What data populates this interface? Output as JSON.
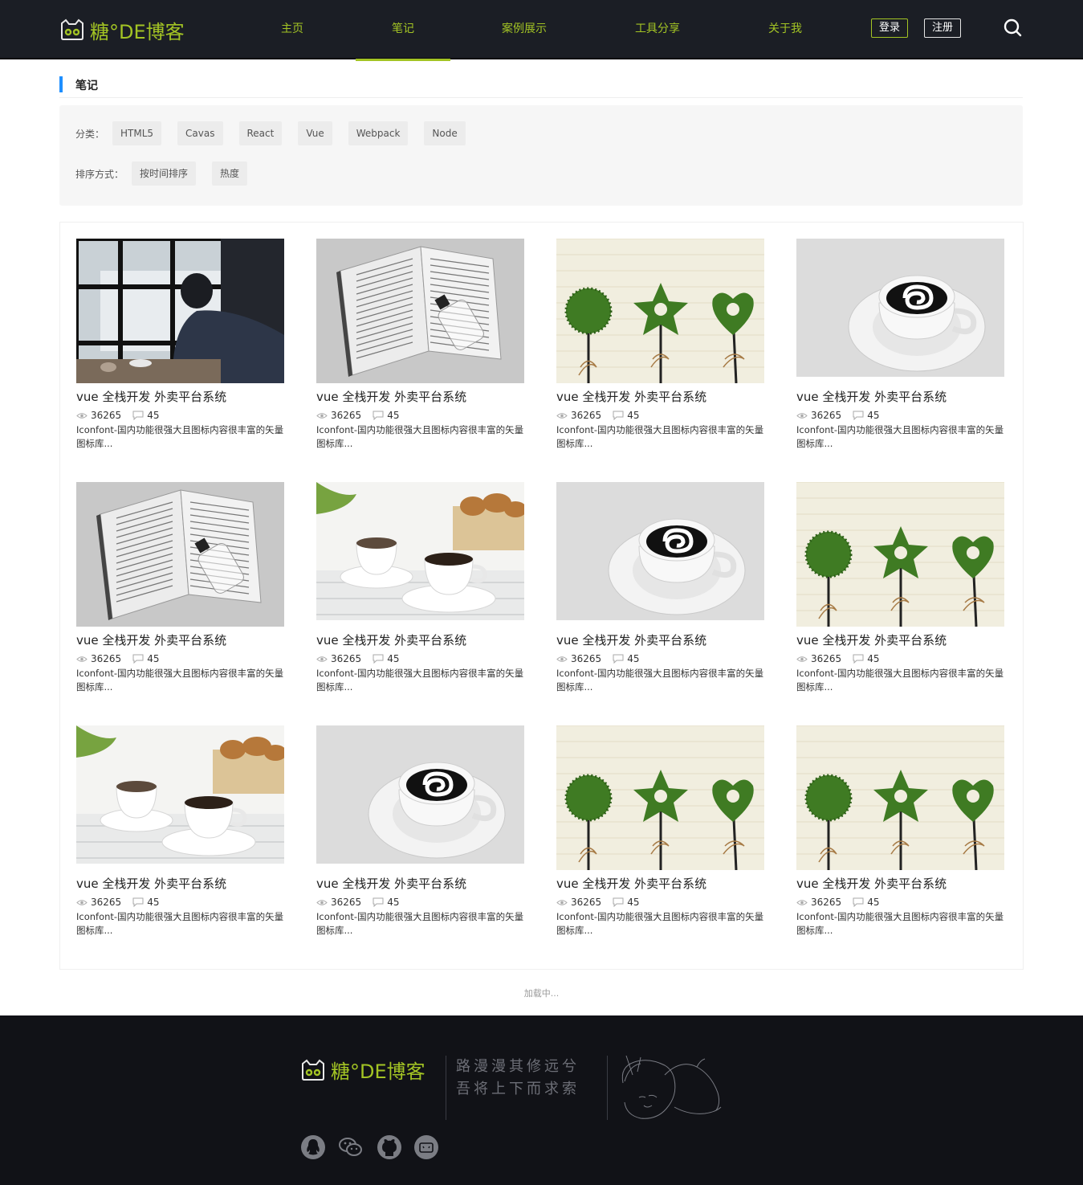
{
  "brand": {
    "name": "糖°DE博客",
    "accent": "#a3c424"
  },
  "nav": {
    "items": [
      {
        "label": "主页"
      },
      {
        "label": "笔记",
        "active": true
      },
      {
        "label": "案例展示"
      },
      {
        "label": "工具分享"
      },
      {
        "label": "关于我"
      }
    ],
    "login_label": "登录",
    "register_label": "注册",
    "search_icon": "search-icon"
  },
  "page": {
    "section_title": "笔记",
    "section_color": "#1e8fff"
  },
  "filter": {
    "category_label": "分类：",
    "categories": [
      "HTML5",
      "Cavas",
      "React",
      "Vue",
      "Webpack",
      "Node"
    ],
    "sort_label": "排序方式：",
    "sort_options": [
      "按时间排序",
      "热度"
    ]
  },
  "cards": [
    {
      "image": "window-man",
      "title": "vue 全栈开发 外卖平台系统",
      "views": "36265",
      "comments": "45",
      "desc": "Iconfont-国内功能很强大且图标内容很丰富的矢量图标库..."
    },
    {
      "image": "open-book",
      "title": "vue 全栈开发 外卖平台系统",
      "views": "36265",
      "comments": "45",
      "desc": "Iconfont-国内功能很强大且图标内容很丰富的矢量图标库..."
    },
    {
      "image": "green-topiary",
      "title": "vue 全栈开发 外卖平台系统",
      "views": "36265",
      "comments": "45",
      "desc": "Iconfont-国内功能很强大且图标内容很丰富的矢量图标库..."
    },
    {
      "image": "swirl-coffee",
      "title": "vue 全栈开发 外卖平台系统",
      "views": "36265",
      "comments": "45",
      "desc": "Iconfont-国内功能很强大且图标内容很丰富的矢量图标库..."
    },
    {
      "image": "open-book",
      "title": "vue 全栈开发 外卖平台系统",
      "views": "36265",
      "comments": "45",
      "desc": "Iconfont-国内功能很强大且图标内容很丰富的矢量图标库..."
    },
    {
      "image": "coffee-cups",
      "title": "vue 全栈开发 外卖平台系统",
      "views": "36265",
      "comments": "45",
      "desc": "Iconfont-国内功能很强大且图标内容很丰富的矢量图标库..."
    },
    {
      "image": "swirl-coffee",
      "title": "vue 全栈开发 外卖平台系统",
      "views": "36265",
      "comments": "45",
      "desc": "Iconfont-国内功能很强大且图标内容很丰富的矢量图标库..."
    },
    {
      "image": "green-topiary",
      "title": "vue 全栈开发 外卖平台系统",
      "views": "36265",
      "comments": "45",
      "desc": "Iconfont-国内功能很强大且图标内容很丰富的矢量图标库..."
    },
    {
      "image": "coffee-cups",
      "title": "vue 全栈开发 外卖平台系统",
      "views": "36265",
      "comments": "45",
      "desc": "Iconfont-国内功能很强大且图标内容很丰富的矢量图标库..."
    },
    {
      "image": "swirl-coffee",
      "title": "vue 全栈开发 外卖平台系统",
      "views": "36265",
      "comments": "45",
      "desc": "Iconfont-国内功能很强大且图标内容很丰富的矢量图标库..."
    },
    {
      "image": "green-topiary",
      "title": "vue 全栈开发 外卖平台系统",
      "views": "36265",
      "comments": "45",
      "desc": "Iconfont-国内功能很强大且图标内容很丰富的矢量图标库..."
    },
    {
      "image": "green-topiary",
      "title": "vue 全栈开发 外卖平台系统",
      "views": "36265",
      "comments": "45",
      "desc": "Iconfont-国内功能很强大且图标内容很丰富的矢量图标库..."
    }
  ],
  "loading_text": "加载中...",
  "footer": {
    "brand": "糖°DE博客",
    "poem_line1": "路漫漫其修远兮",
    "poem_line2": "吾将上下而求索",
    "social": [
      "qq-icon",
      "wechat-icon",
      "github-icon",
      "bilibili-icon"
    ]
  }
}
